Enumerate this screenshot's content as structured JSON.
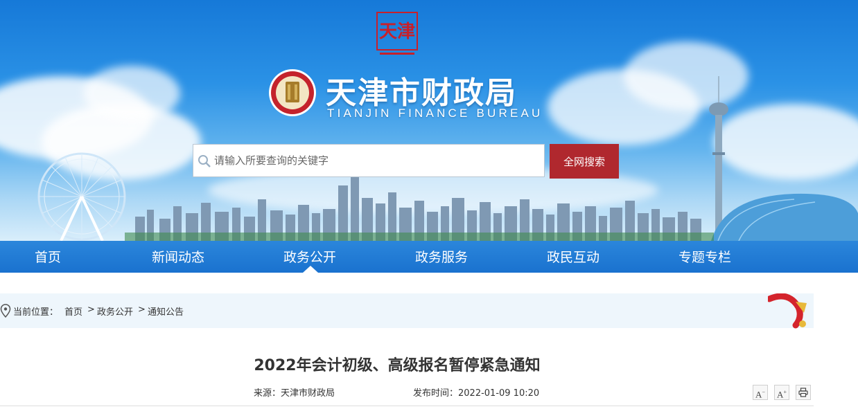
{
  "header": {
    "seal_text": "天津",
    "title": "天津市财政局",
    "subtitle": "TIANJIN FINANCE BUREAU"
  },
  "search": {
    "placeholder": "请输入所要查询的关键字",
    "value": "",
    "button_label": "全网搜索"
  },
  "nav": {
    "items": [
      "首页",
      "新闻动态",
      "政务公开",
      "政务服务",
      "政民互动",
      "专题专栏"
    ],
    "active": "政务公开"
  },
  "breadcrumb": {
    "label": "当前位置：",
    "items": [
      "首页",
      "政务公开",
      "通知公告"
    ],
    "separator": ">"
  },
  "article": {
    "title": "2022年会计初级、高级报名暂停紧急通知",
    "source": "来源：天津市财政局",
    "published": "发布时间：2022-01-09 10:20"
  },
  "tools": {
    "font_smaller": "A",
    "font_larger": "A"
  },
  "colors": {
    "nav_blue": "#1a72cf",
    "search_button_red": "#b0282e",
    "crumb_bg": "#eef6fc"
  }
}
